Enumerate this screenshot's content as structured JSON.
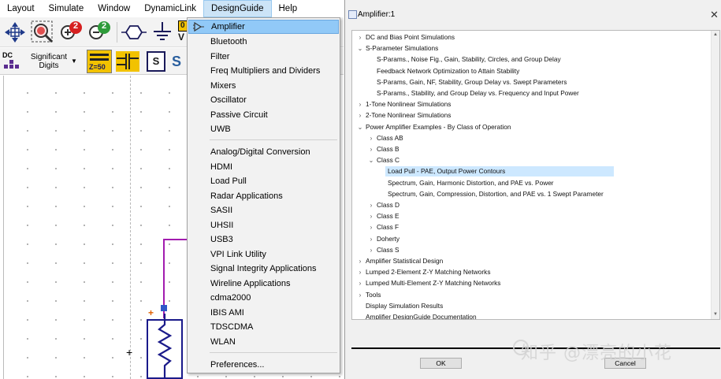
{
  "menubar": {
    "items": [
      "Layout",
      "Simulate",
      "Window",
      "DynamicLink",
      "DesignGuide",
      "Help"
    ],
    "active": "DesignGuide"
  },
  "toolbar": {
    "dc_label": "DC",
    "significant_digits": "Significant\nDigits",
    "sig_line1": "Significant",
    "sig_line2": "Digits",
    "z50_label": "Z=50",
    "s_label": "S",
    "sv_label": "S",
    "zoom_in_badge": "2",
    "zoom_out_badge": "2",
    "v_label": "V",
    "zero_label": "0"
  },
  "schematic": {
    "port_plus": "+"
  },
  "designguide_menu": {
    "items": [
      "Amplifier",
      "Bluetooth",
      "Filter",
      "Freq Multipliers and Dividers",
      "Mixers",
      "Oscillator",
      "Passive Circuit",
      "UWB",
      "Analog/Digital Conversion",
      "HDMI",
      "Load Pull",
      "Radar Applications",
      "SASII",
      "UHSII",
      "USB3",
      "VPI Link Utility",
      "Signal Integrity Applications",
      "Wireline Applications",
      "cdma2000",
      "IBIS AMI",
      "TDSCDMA",
      "WLAN",
      "Preferences..."
    ],
    "selected": "Amplifier"
  },
  "dialog": {
    "title": "Amplifier:1",
    "close": "✕",
    "tree": [
      {
        "label": "DC and Bias Point Simulations",
        "chev": "›"
      },
      {
        "label": "S-Parameter Simulations",
        "chev": "⌄"
      },
      {
        "label": "S-Params., Noise Fig., Gain, Stability, Circles, and Group Delay",
        "chev": ""
      },
      {
        "label": "Feedback Network Optimization to Attain Stability",
        "chev": ""
      },
      {
        "label": "S-Params, Gain, NF, Stability, Group Delay vs. Swept Parameters",
        "chev": ""
      },
      {
        "label": "S-Params., Stability, and Group Delay vs. Frequency and Input Power",
        "chev": ""
      },
      {
        "label": "1-Tone Nonlinear Simulations",
        "chev": "›"
      },
      {
        "label": "2-Tone Nonlinear Simulations",
        "chev": "›"
      },
      {
        "label": "Power Amplifier Examples - By Class of Operation",
        "chev": "⌄"
      },
      {
        "label": "Class AB",
        "chev": "›"
      },
      {
        "label": "Class B",
        "chev": "›"
      },
      {
        "label": "Class C",
        "chev": "⌄"
      },
      {
        "label": "Load Pull - PAE, Output Power Contours",
        "chev": ""
      },
      {
        "label": "Spectrum, Gain, Harmonic Distortion, and PAE vs. Power",
        "chev": ""
      },
      {
        "label": "Spectrum, Gain, Compression, Distortion, and PAE vs. 1 Swept Parameter",
        "chev": ""
      },
      {
        "label": "Class D",
        "chev": "›"
      },
      {
        "label": "Class E",
        "chev": "›"
      },
      {
        "label": "Class F",
        "chev": "›"
      },
      {
        "label": "Doherty",
        "chev": "›"
      },
      {
        "label": "Class S",
        "chev": "›"
      },
      {
        "label": "Amplifier Statistical Design",
        "chev": "›"
      },
      {
        "label": "Lumped 2-Element Z-Y Matching Networks",
        "chev": "›"
      },
      {
        "label": "Lumped Multi-Element Z-Y Matching Networks",
        "chev": "›"
      },
      {
        "label": "Tools",
        "chev": "›"
      },
      {
        "label": "Display Simulation Results",
        "chev": ""
      },
      {
        "label": "Amplifier DesignGuide Documentation",
        "chev": ""
      }
    ],
    "selected_row": "Load Pull - PAE, Output Power Contours",
    "ok_label": "OK",
    "cancel_label": "Cancel"
  },
  "watermark": "知乎 @漂亮的小花"
}
